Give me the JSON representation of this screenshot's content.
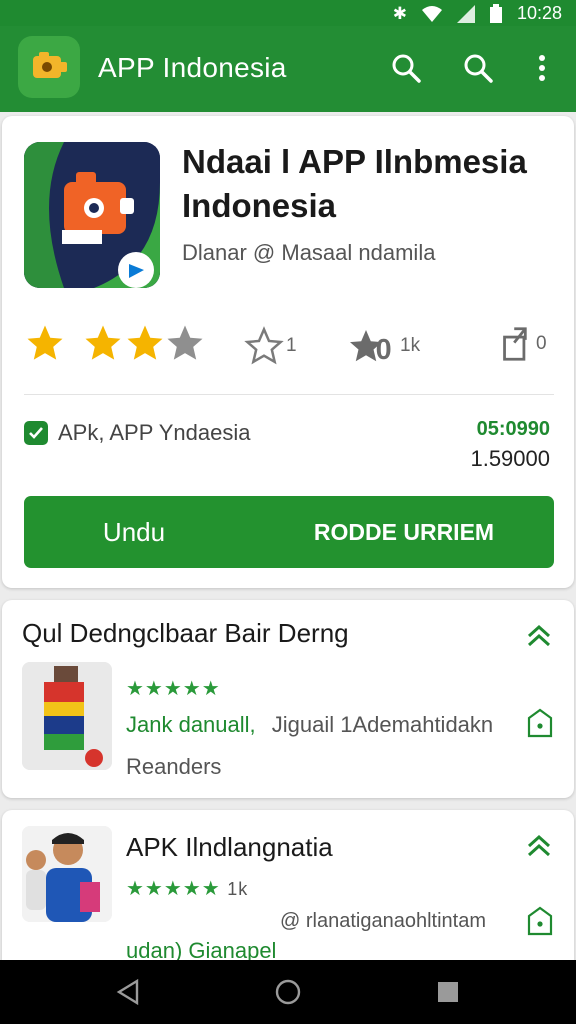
{
  "status": {
    "time": "10:28"
  },
  "appbar": {
    "title": "APP Indonesia"
  },
  "app": {
    "title": "Ndaai l APP Ilnbmesia Indonesia",
    "developer": "Dlanar @ Masaal ndamila"
  },
  "rating_stats": {
    "stat1": "1",
    "stat2": "1k",
    "stat3": "0"
  },
  "apk": {
    "label": "APk, APP Yndaesia",
    "price_green": "05:0990",
    "price": "1.59000"
  },
  "buttons": {
    "left": "Undu",
    "right": "RODDE URRIEM"
  },
  "section": {
    "title": "Qul Dedngclbaar Bair Derng",
    "items": [
      {
        "stars": "★★★★★",
        "line_green": "Jank danuall,",
        "line_grey": "Jiguail 1Ademahtidakn",
        "sub": "Reanders"
      },
      {
        "title": "APK Ilndlangnatia",
        "stars": "★★★★★",
        "stars_count": "1k",
        "handle": "@ rlanatiganaohltintam",
        "bottom": "udan) Gianapel"
      }
    ]
  },
  "colors": {
    "primary": "#238d34",
    "star": "#f5b400",
    "white": "#ffffff"
  }
}
